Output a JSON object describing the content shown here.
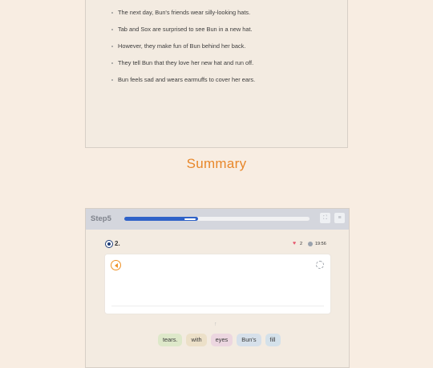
{
  "story": {
    "items": [
      "The next day, Bun's friends wear silly-looking hats.",
      "Tab and Sox are surprised to see Bun in a new hat.",
      "However, they make fun of Bun behind her back.",
      "They tell Bun that they love her new hat and run off.",
      "Bun feels sad and wears earmuffs to cover her ears."
    ]
  },
  "summary_title": "Summary",
  "step": {
    "label": "Step5",
    "progress_fraction": 0.4,
    "question_number": "2.",
    "hearts": "2",
    "timer": "19:56",
    "icons": {
      "audio": "speaker-icon",
      "reset": "reset-icon",
      "expand": "expand-icon",
      "menu": "menu-icon",
      "heart": "heart-icon",
      "timer": "clock-icon"
    }
  },
  "word_bank": [
    {
      "text": "tears.",
      "color": "#dde8c9"
    },
    {
      "text": "with",
      "color": "#ece0c8"
    },
    {
      "text": "eyes",
      "color": "#ecd6e0"
    },
    {
      "text": "Bun's",
      "color": "#d6e0ea"
    },
    {
      "text": "fill",
      "color": "#d4e1ea"
    }
  ],
  "colors": {
    "accent": "#e8872a",
    "progress": "#2f62c8",
    "background": "#f8ede2"
  }
}
